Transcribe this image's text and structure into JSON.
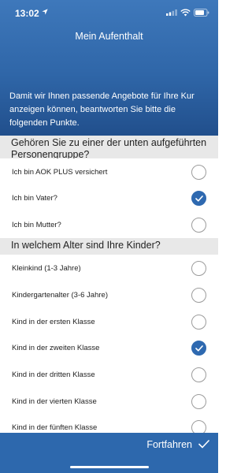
{
  "status": {
    "time": "13:02"
  },
  "nav": {
    "title": "Mein Aufenthalt"
  },
  "intro": "Damit wir Ihnen passende Angebote für Ihre Kur anzeigen können, beantworten Sie bitte die folgenden Punkte.",
  "group_section": {
    "title": "Gehören Sie zu einer der unten aufgeführten Personengruppe?",
    "options": [
      {
        "label": "Ich bin AOK PLUS versichert",
        "checked": false
      },
      {
        "label": "Ich bin Vater?",
        "checked": true
      },
      {
        "label": "Ich bin Mutter?",
        "checked": false
      }
    ]
  },
  "age_section": {
    "title": "In welchem Alter sind Ihre Kinder?",
    "options": [
      {
        "label": "Kleinkind (1-3 Jahre)",
        "checked": false
      },
      {
        "label": "Kindergartenalter (3-6 Jahre)",
        "checked": false
      },
      {
        "label": "Kind in der ersten Klasse",
        "checked": false
      },
      {
        "label": "Kind in der zweiten Klasse",
        "checked": true
      },
      {
        "label": "Kind in der dritten Klasse",
        "checked": false
      },
      {
        "label": "Kind in der vierten Klasse",
        "checked": false
      },
      {
        "label": "Kind in der fünften Klasse",
        "checked": false
      }
    ]
  },
  "footer": {
    "continue_label": "Fortfahren"
  },
  "colors": {
    "header": "#2f66a8",
    "accent": "#2e69b0",
    "section_bg": "#e8e8e8"
  },
  "icons": [
    "location-arrow-icon",
    "signal-icon",
    "wifi-icon",
    "battery-icon",
    "checkmark-icon"
  ]
}
